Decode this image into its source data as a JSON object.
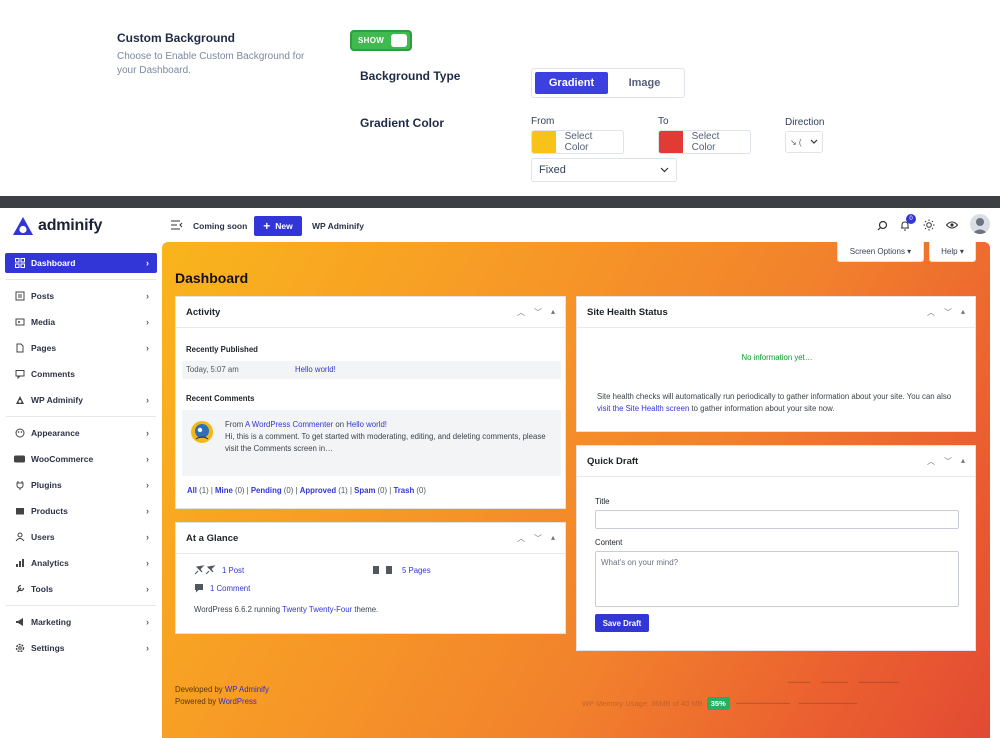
{
  "settings": {
    "custom_bg": {
      "title": "Custom Background",
      "description": "Choose to Enable Custom Background for your Dashboard.",
      "toggle_label": "SHOW"
    },
    "bg_type": {
      "label": "Background Type",
      "options": [
        "Gradient",
        "Image"
      ],
      "selected": "Gradient"
    },
    "gradient": {
      "label": "Gradient Color",
      "from_label": "From",
      "from_color": "#f9c21a",
      "from_button": "Select Color",
      "to_label": "To",
      "to_color": "#e23b35",
      "to_button": "Select Color",
      "direction_label": "Direction",
      "direction_value": "↘ (",
      "attachment_value": "Fixed"
    }
  },
  "app": {
    "brand": "adminify",
    "topbar": {
      "coming_soon": "Coming soon",
      "new_label": "New",
      "site_name": "WP Adminify",
      "notif_count": "0"
    },
    "sidebar": {
      "items": [
        {
          "label": "Dashboard",
          "icon": "grid-icon"
        },
        {
          "label": "Posts",
          "icon": "posts-icon"
        },
        {
          "label": "Media",
          "icon": "media-icon"
        },
        {
          "label": "Pages",
          "icon": "pages-icon"
        },
        {
          "label": "Comments",
          "icon": "comments-icon"
        },
        {
          "label": "WP Adminify",
          "icon": "adminify-icon"
        },
        {
          "label": "Appearance",
          "icon": "appearance-icon"
        },
        {
          "label": "WooCommerce",
          "icon": "woocommerce-icon"
        },
        {
          "label": "Plugins",
          "icon": "plugins-icon"
        },
        {
          "label": "Products",
          "icon": "products-icon"
        },
        {
          "label": "Users",
          "icon": "users-icon"
        },
        {
          "label": "Analytics",
          "icon": "analytics-icon"
        },
        {
          "label": "Tools",
          "icon": "tools-icon"
        },
        {
          "label": "Marketing",
          "icon": "marketing-icon"
        },
        {
          "label": "Settings",
          "icon": "settings-icon"
        }
      ]
    },
    "screen_options": "Screen Options ▾",
    "help": "Help ▾",
    "page_title": "Dashboard",
    "activity": {
      "title": "Activity",
      "recently_published": "Recently Published",
      "published_time": "Today, 5:07 am",
      "published_link": "Hello world!",
      "recent_comments": "Recent Comments",
      "comment_from": "From",
      "comment_author": "A WordPress Commenter",
      "comment_on": "on",
      "comment_post": "Hello world!",
      "comment_text": "Hi, this is a comment. To get started with moderating, editing, and deleting comments, please visit the Comments screen in…",
      "filters": [
        {
          "label": "All",
          "count": "(1)"
        },
        {
          "label": "Mine",
          "count": "(0)"
        },
        {
          "label": "Pending",
          "count": "(0)"
        },
        {
          "label": "Approved",
          "count": "(1)"
        },
        {
          "label": "Spam",
          "count": "(0)"
        },
        {
          "label": "Trash",
          "count": "(0)"
        }
      ]
    },
    "glance": {
      "title": "At a Glance",
      "posts": "1 Post",
      "pages": "5 Pages",
      "comments": "1 Comment",
      "wp_version_text": "WordPress 6.6.2 running",
      "theme_link": "Twenty Twenty-Four",
      "theme_suffix": "theme."
    },
    "health": {
      "title": "Site Health Status",
      "status": "No information yet…",
      "text_before": "Site health checks will automatically run periodically to gather information about your site. You can also",
      "link": "visit the Site Health screen",
      "text_after": "to gather information about your site now."
    },
    "draft": {
      "title": "Quick Draft",
      "title_label": "Title",
      "content_label": "Content",
      "content_placeholder": "What's on your mind?",
      "save_label": "Save Draft"
    },
    "footer": {
      "developed_by": "Developed by",
      "developed_link": "WP Adminify",
      "powered_by": "Powered by",
      "powered_link": "WordPress",
      "memory_text": "WP Memory Usage: 36MB of 40 MB",
      "memory_pct": "35%"
    }
  },
  "colors": {
    "accent": "#3236d6",
    "toggle": "#3fb950",
    "gradient_start": "#f9b51c",
    "gradient_end": "#e24a33"
  }
}
